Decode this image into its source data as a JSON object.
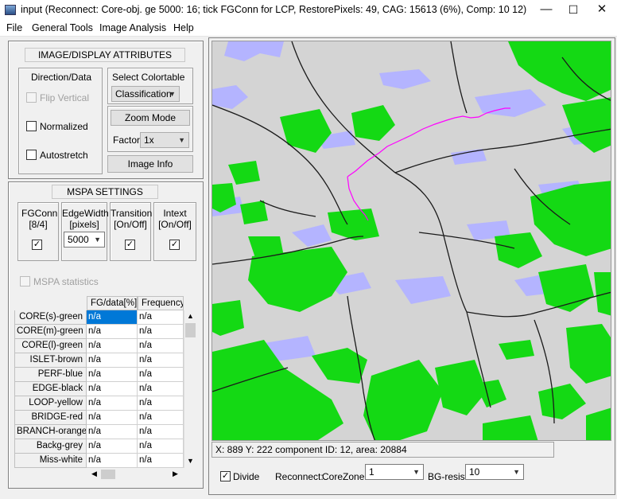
{
  "window": {
    "title": "input (Reconnect:  Core-obj. ge 5000: 16; tick FGConn for LCP, RestorePixels: 49, CAG: 15613 (6%), Comp: 10 12)",
    "minimize_glyph": "—",
    "maximize_glyph": "☐",
    "close_glyph": "✕"
  },
  "menu": [
    "File",
    "General Tools",
    "Image Analysis",
    "Help"
  ],
  "image_display": {
    "header": "IMAGE/DISPLAY ATTRIBUTES",
    "direction_label": "Direction/Data",
    "flip_vertical": {
      "label": "Flip Vertical",
      "checked": false,
      "enabled": false
    },
    "normalized": {
      "label": "Normalized",
      "checked": false
    },
    "autostretch": {
      "label": "Autostretch",
      "checked": false
    },
    "colortable_label": "Select Colortable",
    "colortable_value": "Classification",
    "zoom_mode_button": "Zoom Mode",
    "factor_label": "Factor:",
    "factor_value": "1x",
    "image_info_button": "Image Info"
  },
  "mspa": {
    "header": "MSPA SETTINGS",
    "fgconn_label1": "FGConn",
    "fgconn_label2": "[8/4]",
    "edgewidth_label1": "EdgeWidth",
    "edgewidth_label2": "[pixels]",
    "edgewidth_value": "5000",
    "transition_label1": "Transition",
    "transition_label2": "[On/Off]",
    "intext_label1": "Intext",
    "intext_label2": "[On/Off]",
    "check_glyph": "✓",
    "statistics_label": "MSPA statistics"
  },
  "stats": {
    "columns": [
      "FG/data[%]",
      "Frequency"
    ],
    "rows": [
      {
        "label": "CORE(s)-green",
        "fg": "n/a",
        "freq": "n/a"
      },
      {
        "label": "CORE(m)-green",
        "fg": "n/a",
        "freq": "n/a"
      },
      {
        "label": "CORE(l)-green",
        "fg": "n/a",
        "freq": "n/a"
      },
      {
        "label": "ISLET-brown",
        "fg": "n/a",
        "freq": "n/a"
      },
      {
        "label": "PERF-blue",
        "fg": "n/a",
        "freq": "n/a"
      },
      {
        "label": "EDGE-black",
        "fg": "n/a",
        "freq": "n/a"
      },
      {
        "label": "LOOP-yellow",
        "fg": "n/a",
        "freq": "n/a"
      },
      {
        "label": "BRIDGE-red",
        "fg": "n/a",
        "freq": "n/a"
      },
      {
        "label": "BRANCH-orange",
        "fg": "n/a",
        "freq": "n/a"
      },
      {
        "label": "Backg-grey",
        "fg": "n/a",
        "freq": "n/a"
      },
      {
        "label": "Miss-white",
        "fg": "n/a",
        "freq": "n/a"
      }
    ]
  },
  "status_bar": {
    "text": "X: 889   Y: 222   component ID: 12, area: 20884"
  },
  "bottom": {
    "divide": {
      "label": "Divide",
      "checked": true
    },
    "reconnect_label": "Reconnect:",
    "corezone_label": "CoreZone:",
    "corezone_value": "1",
    "bgresist_label": "BG-resist:",
    "bgresist_value": "10"
  },
  "colors": {
    "core_green": "#14d914",
    "perf_blue": "#b4b4ff",
    "background_grey": "#d4d4d4",
    "edge_black": "#1a1a1a",
    "path_magenta": "#ff00ff",
    "selection_blue": "#0078d7"
  }
}
